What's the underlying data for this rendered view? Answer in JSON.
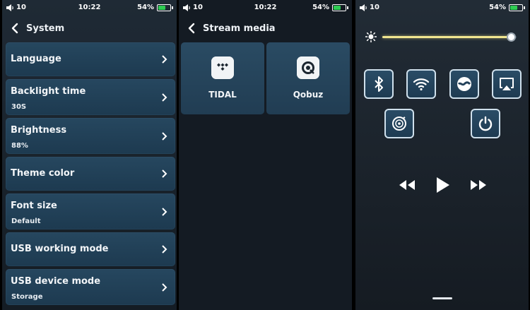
{
  "status": {
    "time_left": "10:22",
    "time_mid": "10:22",
    "volume": "10",
    "battery": "54%",
    "battery_level": 0.54
  },
  "system": {
    "title": "System",
    "items": [
      {
        "label": "Language",
        "value": ""
      },
      {
        "label": "Backlight time",
        "value": "30S"
      },
      {
        "label": "Brightness",
        "value": "88%"
      },
      {
        "label": "Theme color",
        "value": ""
      },
      {
        "label": "Font size",
        "value": "Default"
      },
      {
        "label": "USB working mode",
        "value": ""
      },
      {
        "label": "USB device mode",
        "value": "Storage"
      }
    ]
  },
  "stream": {
    "title": "Stream media",
    "services": [
      {
        "label": "TIDAL",
        "icon": "tidal-icon"
      },
      {
        "label": "Qobuz",
        "icon": "qobuz-icon"
      }
    ]
  },
  "control": {
    "brightness_level": 0.96,
    "toggles": [
      "bluetooth-icon",
      "wifi-icon",
      "streaming-icon",
      "airplay-icon",
      "disc-icon",
      "power-icon"
    ],
    "accent_color": "#f0e690"
  },
  "colors": {
    "battery": "#2ecc52",
    "card": "#26475f",
    "background": "#141c24"
  }
}
